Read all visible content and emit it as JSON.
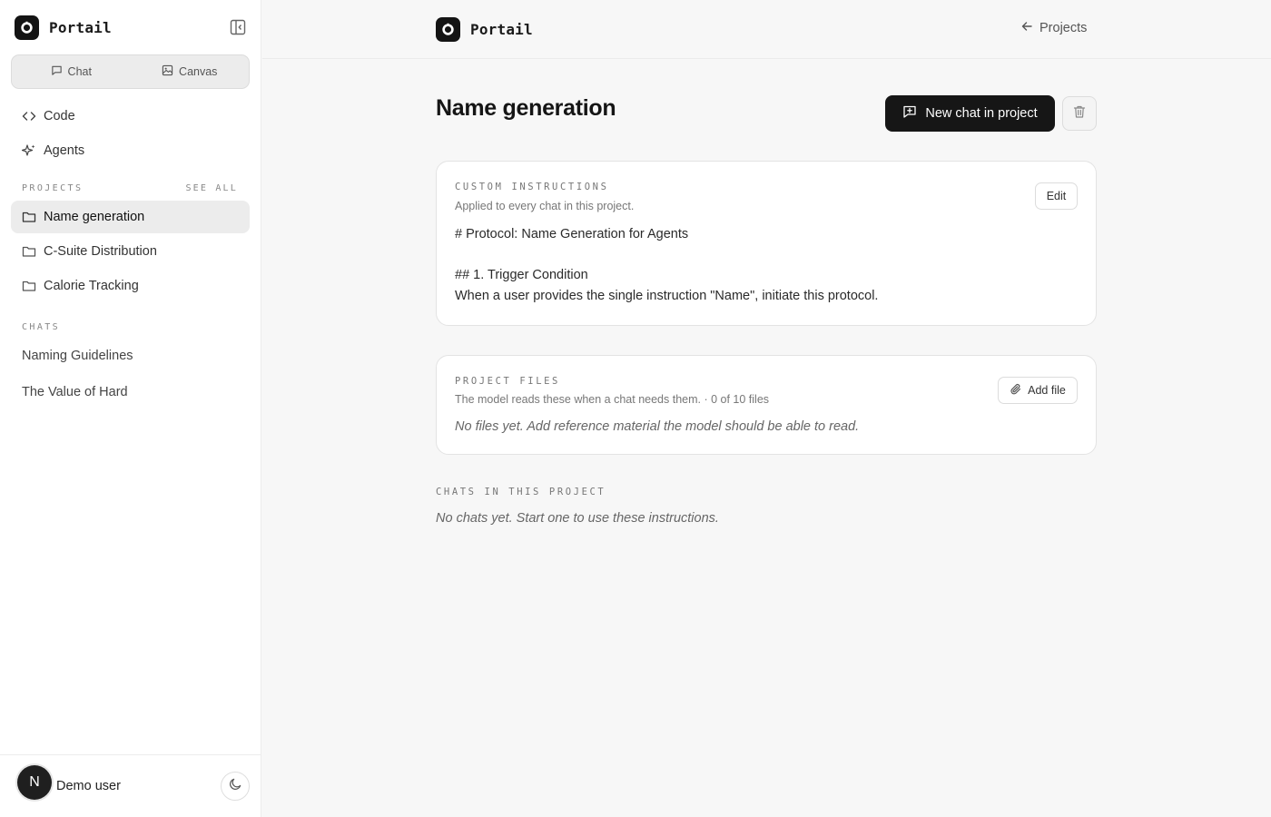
{
  "app": {
    "name": "Portail"
  },
  "sidebar": {
    "modes": [
      {
        "label": "Chat"
      },
      {
        "label": "Canvas"
      }
    ],
    "nav": [
      {
        "label": "Code"
      },
      {
        "label": "Agents"
      }
    ],
    "projects_label": "PROJECTS",
    "see_all_label": "SEE ALL",
    "projects": [
      {
        "label": "Name generation",
        "active": true
      },
      {
        "label": "C-Suite Distribution"
      },
      {
        "label": "Calorie Tracking"
      }
    ],
    "chats_label": "CHATS",
    "chats": [
      {
        "label": "Naming Guidelines"
      },
      {
        "label": "The Value of Hard"
      }
    ],
    "user": {
      "initial": "N",
      "name": "Demo user"
    }
  },
  "topbar": {
    "back_label": "Projects"
  },
  "main": {
    "title": "Name generation",
    "new_chat_label": "New chat in project",
    "instructions": {
      "label": "CUSTOM INSTRUCTIONS",
      "subtitle": "Applied to every chat in this project.",
      "edit_label": "Edit",
      "lines": [
        "# Protocol: Name Generation for Agents",
        "## 1. Trigger Condition",
        "When a user provides the single instruction \"Name\", initiate this protocol."
      ]
    },
    "files": {
      "label": "PROJECT FILES",
      "subtitle": "The model reads these when a chat needs them. · 0 of 10 files",
      "add_label": "Add file",
      "empty": "No files yet. Add reference material the model should be able to read."
    },
    "chats": {
      "label": "CHATS IN THIS PROJECT",
      "empty": "No chats yet. Start one to use these instructions."
    }
  }
}
